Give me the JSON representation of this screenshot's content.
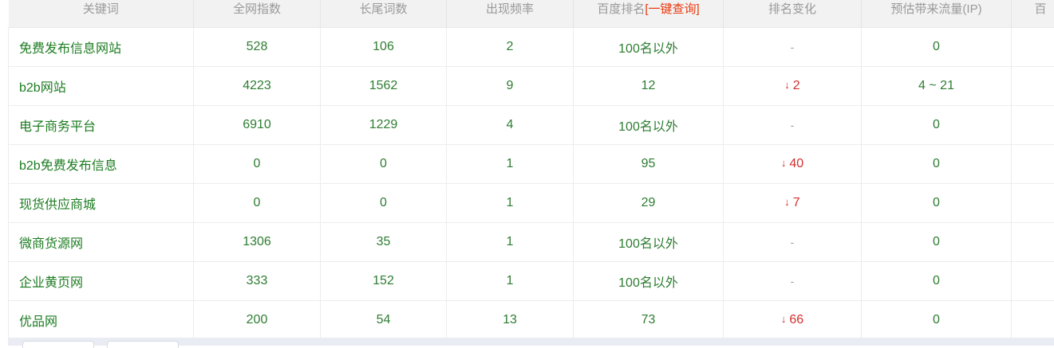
{
  "table": {
    "headers": {
      "keyword": "关键词",
      "total_index": "全网指数",
      "longtail": "长尾词数",
      "frequency": "出现频率",
      "baidu_rank": "百度排名",
      "baidu_rank_link": "[一键查询]",
      "rank_change": "排名变化",
      "traffic": "预估带来流量(IP)",
      "extra": "百"
    },
    "rows": [
      {
        "keyword": "免费发布信息网站",
        "total_index": "528",
        "longtail": "106",
        "frequency": "2",
        "baidu_rank": "100名以外",
        "rank_change": "-",
        "traffic": "0"
      },
      {
        "keyword": "b2b网站",
        "total_index": "4223",
        "longtail": "1562",
        "frequency": "9",
        "baidu_rank": "12",
        "rank_change": "2",
        "traffic": "4 ~ 21"
      },
      {
        "keyword": "电子商务平台",
        "total_index": "6910",
        "longtail": "1229",
        "frequency": "4",
        "baidu_rank": "100名以外",
        "rank_change": "-",
        "traffic": "0"
      },
      {
        "keyword": "b2b免费发布信息",
        "total_index": "0",
        "longtail": "0",
        "frequency": "1",
        "baidu_rank": "95",
        "rank_change": "40",
        "traffic": "0"
      },
      {
        "keyword": "现货供应商城",
        "total_index": "0",
        "longtail": "0",
        "frequency": "1",
        "baidu_rank": "29",
        "rank_change": "7",
        "traffic": "0"
      },
      {
        "keyword": "微商货源网",
        "total_index": "1306",
        "longtail": "35",
        "frequency": "1",
        "baidu_rank": "100名以外",
        "rank_change": "-",
        "traffic": "0"
      },
      {
        "keyword": "企业黄页网",
        "total_index": "333",
        "longtail": "152",
        "frequency": "1",
        "baidu_rank": "100名以外",
        "rank_change": "-",
        "traffic": "0"
      },
      {
        "keyword": "优品网",
        "total_index": "200",
        "longtail": "54",
        "frequency": "13",
        "baidu_rank": "73",
        "rank_change": "66",
        "traffic": "0"
      }
    ]
  },
  "icons": {
    "rank_down": "arrow-down-icon",
    "no_change": "dash"
  },
  "colors": {
    "keyword": "#1c7c21",
    "value": "#2e7d32",
    "down": "#d32f2f",
    "link": "#e8380d",
    "header_bg": "#f2f2f2"
  }
}
